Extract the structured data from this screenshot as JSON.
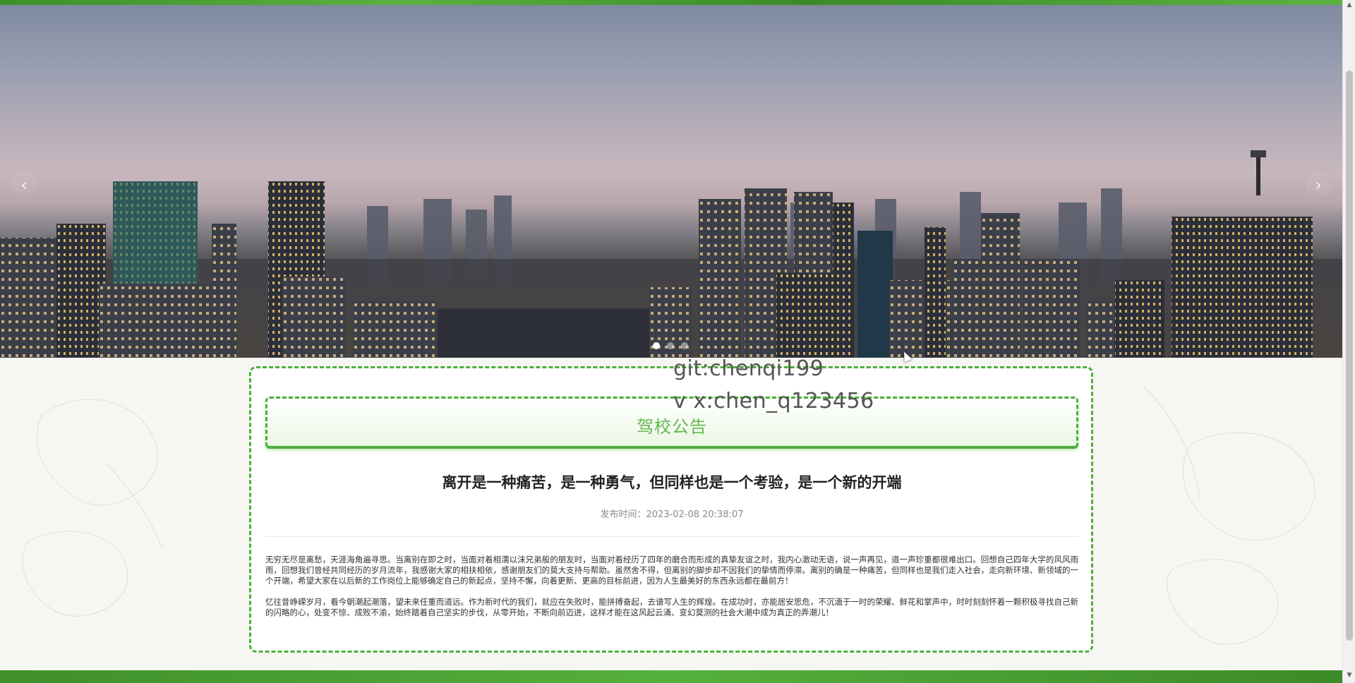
{
  "carousel": {
    "prev_glyph": "‹",
    "next_glyph": "›",
    "dots": [
      true,
      false,
      false
    ]
  },
  "watermark": {
    "line1": "git:chenqi199",
    "line2": "v x:chen_q123456"
  },
  "notice": {
    "header_title": "驾校公告",
    "article_title": "离开是一种痛苦，是一种勇气，但同样也是一个考验，是一个新的开端",
    "publish_line": "发布时间：2023-02-08 20:38:07",
    "paragraphs": [
      "无穷无尽是离愁，天涯海角遍寻思。当离别在即之时，当面对着相濡以沫兄弟般的朋友时，当面对着经历了四年的磨合而形成的真挚友谊之时，我内心激动无语，说一声再见，道一声珍重都很难出口。回想自己四年大学的风风雨雨，回想我们曾经共同经历的岁月流年，我感谢大家的相扶相依，感谢朋友们的莫大支持与帮助。虽然舍不得，但离别的脚步却不因我们的挚情而停滞。离别的确是一种痛苦，但同样也是我们走入社会，走向新环境、新领域的一个开端，希望大家在以后新的工作岗位上能够确定自己的新起点，坚持不懈，向着更新、更高的目标前进，因为人生最美好的东西永远都在最前方！",
      "忆往昔峥嵘岁月，看今朝潮起潮落，望未来任重而道远。作为新时代的我们，就应在失败时，能拼搏奋起，去谱写人生的辉煌。在成功时，亦能居安思危，不沉湎于一时的荣耀、鲜花和掌声中，时时刻刻怀着一颗积极寻找自己新的闪略的心，处变不惊、成败不渝，始终踏着自己坚实的步伐，从零开始，不断向前迈进，这样才能在这风起云涌、变幻莫测的社会大潮中成为真正的弄潮儿！"
    ]
  },
  "scrollbar": {
    "up_glyph": "▲",
    "down_glyph": "▼"
  }
}
